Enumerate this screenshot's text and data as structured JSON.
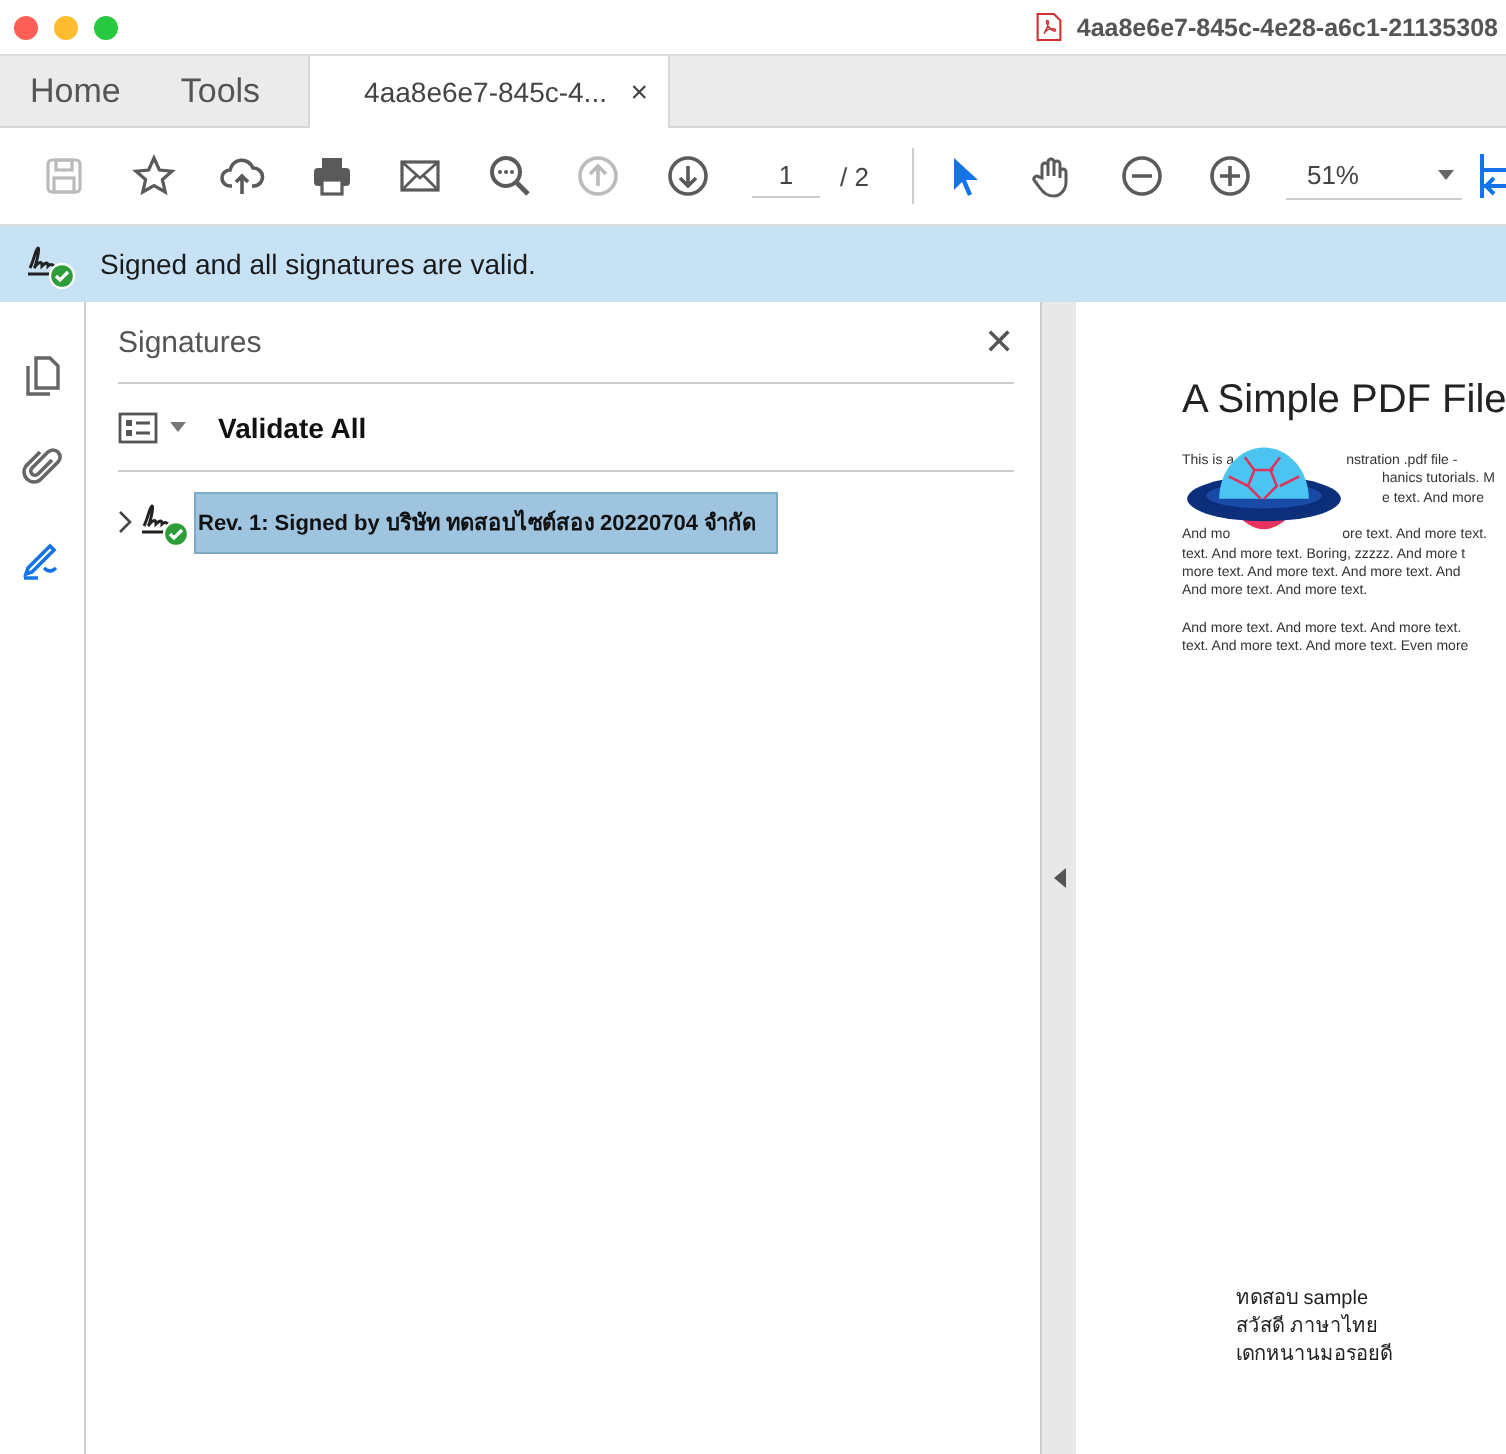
{
  "window": {
    "title": "4aa8e6e7-845c-4e28-a6c1-21135308"
  },
  "tabs": [
    {
      "label": "Home",
      "kind": "nav",
      "selected": false
    },
    {
      "label": "Tools",
      "kind": "nav",
      "selected": false
    },
    {
      "label": "4aa8e6e7-845c-4...",
      "kind": "document",
      "selected": true,
      "close": "×"
    }
  ],
  "toolbar": {
    "tools": [
      {
        "kind": "save",
        "disabled": true
      },
      {
        "kind": "star",
        "disabled": false
      },
      {
        "kind": "upload",
        "disabled": false
      },
      {
        "kind": "print",
        "disabled": false
      },
      {
        "kind": "mail",
        "disabled": false
      },
      {
        "kind": "find",
        "disabled": false
      },
      {
        "kind": "up",
        "disabled": true
      },
      {
        "kind": "down",
        "disabled": false
      }
    ],
    "page": {
      "value": "1",
      "total": "/ 2"
    },
    "modes": [
      {
        "kind": "pointer",
        "selected": true
      },
      {
        "kind": "hand",
        "selected": false
      },
      {
        "kind": "zoom-out",
        "selected": false
      },
      {
        "kind": "zoom-in",
        "selected": false
      }
    ],
    "zoom": {
      "value": "51%"
    }
  },
  "banner": {
    "text": "Signed and all signatures are valid."
  },
  "rail": [
    {
      "kind": "pages",
      "selected": false
    },
    {
      "kind": "attachments",
      "selected": false
    },
    {
      "kind": "signatures",
      "selected": true
    }
  ],
  "panel": {
    "title": "Signatures",
    "close": "✕",
    "validate_label": "Validate All",
    "signatures": [
      {
        "label": "Rev. 1: Signed by บริษัท ทดสอบไซต์สอง 20220704 จำกัด",
        "expanded": false,
        "selected": true
      }
    ]
  },
  "document": {
    "title": "A Simple PDF File",
    "paragraphs": [
      [
        {
          "kind": "split",
          "parts": [
            "This is a",
            "nstration .pdf file -"
          ]
        },
        {
          "kind": "tail",
          "parts": [
            "hanics tutorials. M"
          ]
        },
        {
          "kind": "tail",
          "parts": [
            "e text. And more"
          ]
        }
      ],
      [
        {
          "kind": "split",
          "parts": [
            "And mo",
            "ore text. And more text."
          ]
        },
        {
          "kind": "plain",
          "parts": [
            "text. And more text. Boring, zzzzz. And more t"
          ]
        },
        {
          "kind": "plain",
          "parts": [
            "more text. And more text. And more text. And"
          ]
        },
        {
          "kind": "plain",
          "parts": [
            "And more text. And more text."
          ]
        }
      ],
      [
        {
          "kind": "plain",
          "parts": [
            "And more text. And more text. And more text."
          ]
        },
        {
          "kind": "plain",
          "parts": [
            "text. And more text. And more text. Even more"
          ]
        }
      ]
    ],
    "footer_lines": [
      "ทดสอบ sample",
      "สวัสดี ภาษาไทย",
      "เดกหนานมอรอยดี"
    ]
  }
}
